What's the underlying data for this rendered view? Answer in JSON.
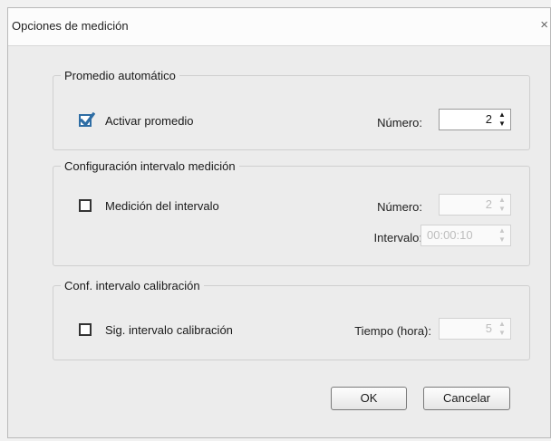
{
  "window": {
    "title": "Opciones de medición",
    "close_glyph": "×"
  },
  "auto_average": {
    "legend": "Promedio automático",
    "enable_label": "Activar promedio",
    "enable_checked": true,
    "number_label": "Número:",
    "number_value": "2"
  },
  "interval_config": {
    "legend": "Configuración intervalo medición",
    "enable_label": "Medición del intervalo",
    "enable_checked": false,
    "number_label": "Número:",
    "number_value": "2",
    "interval_label": "Intervalo:",
    "interval_value": "00:00:10"
  },
  "calibration": {
    "legend": "Conf. intervalo calibración",
    "enable_label": "Sig. intervalo calibración",
    "enable_checked": false,
    "time_label": "Tiempo (hora):",
    "time_value": "5"
  },
  "buttons": {
    "ok": "OK",
    "cancel": "Cancelar"
  },
  "colors": {
    "check_accent": "#2e6da4",
    "disabled_text": "#bdbdbd"
  }
}
